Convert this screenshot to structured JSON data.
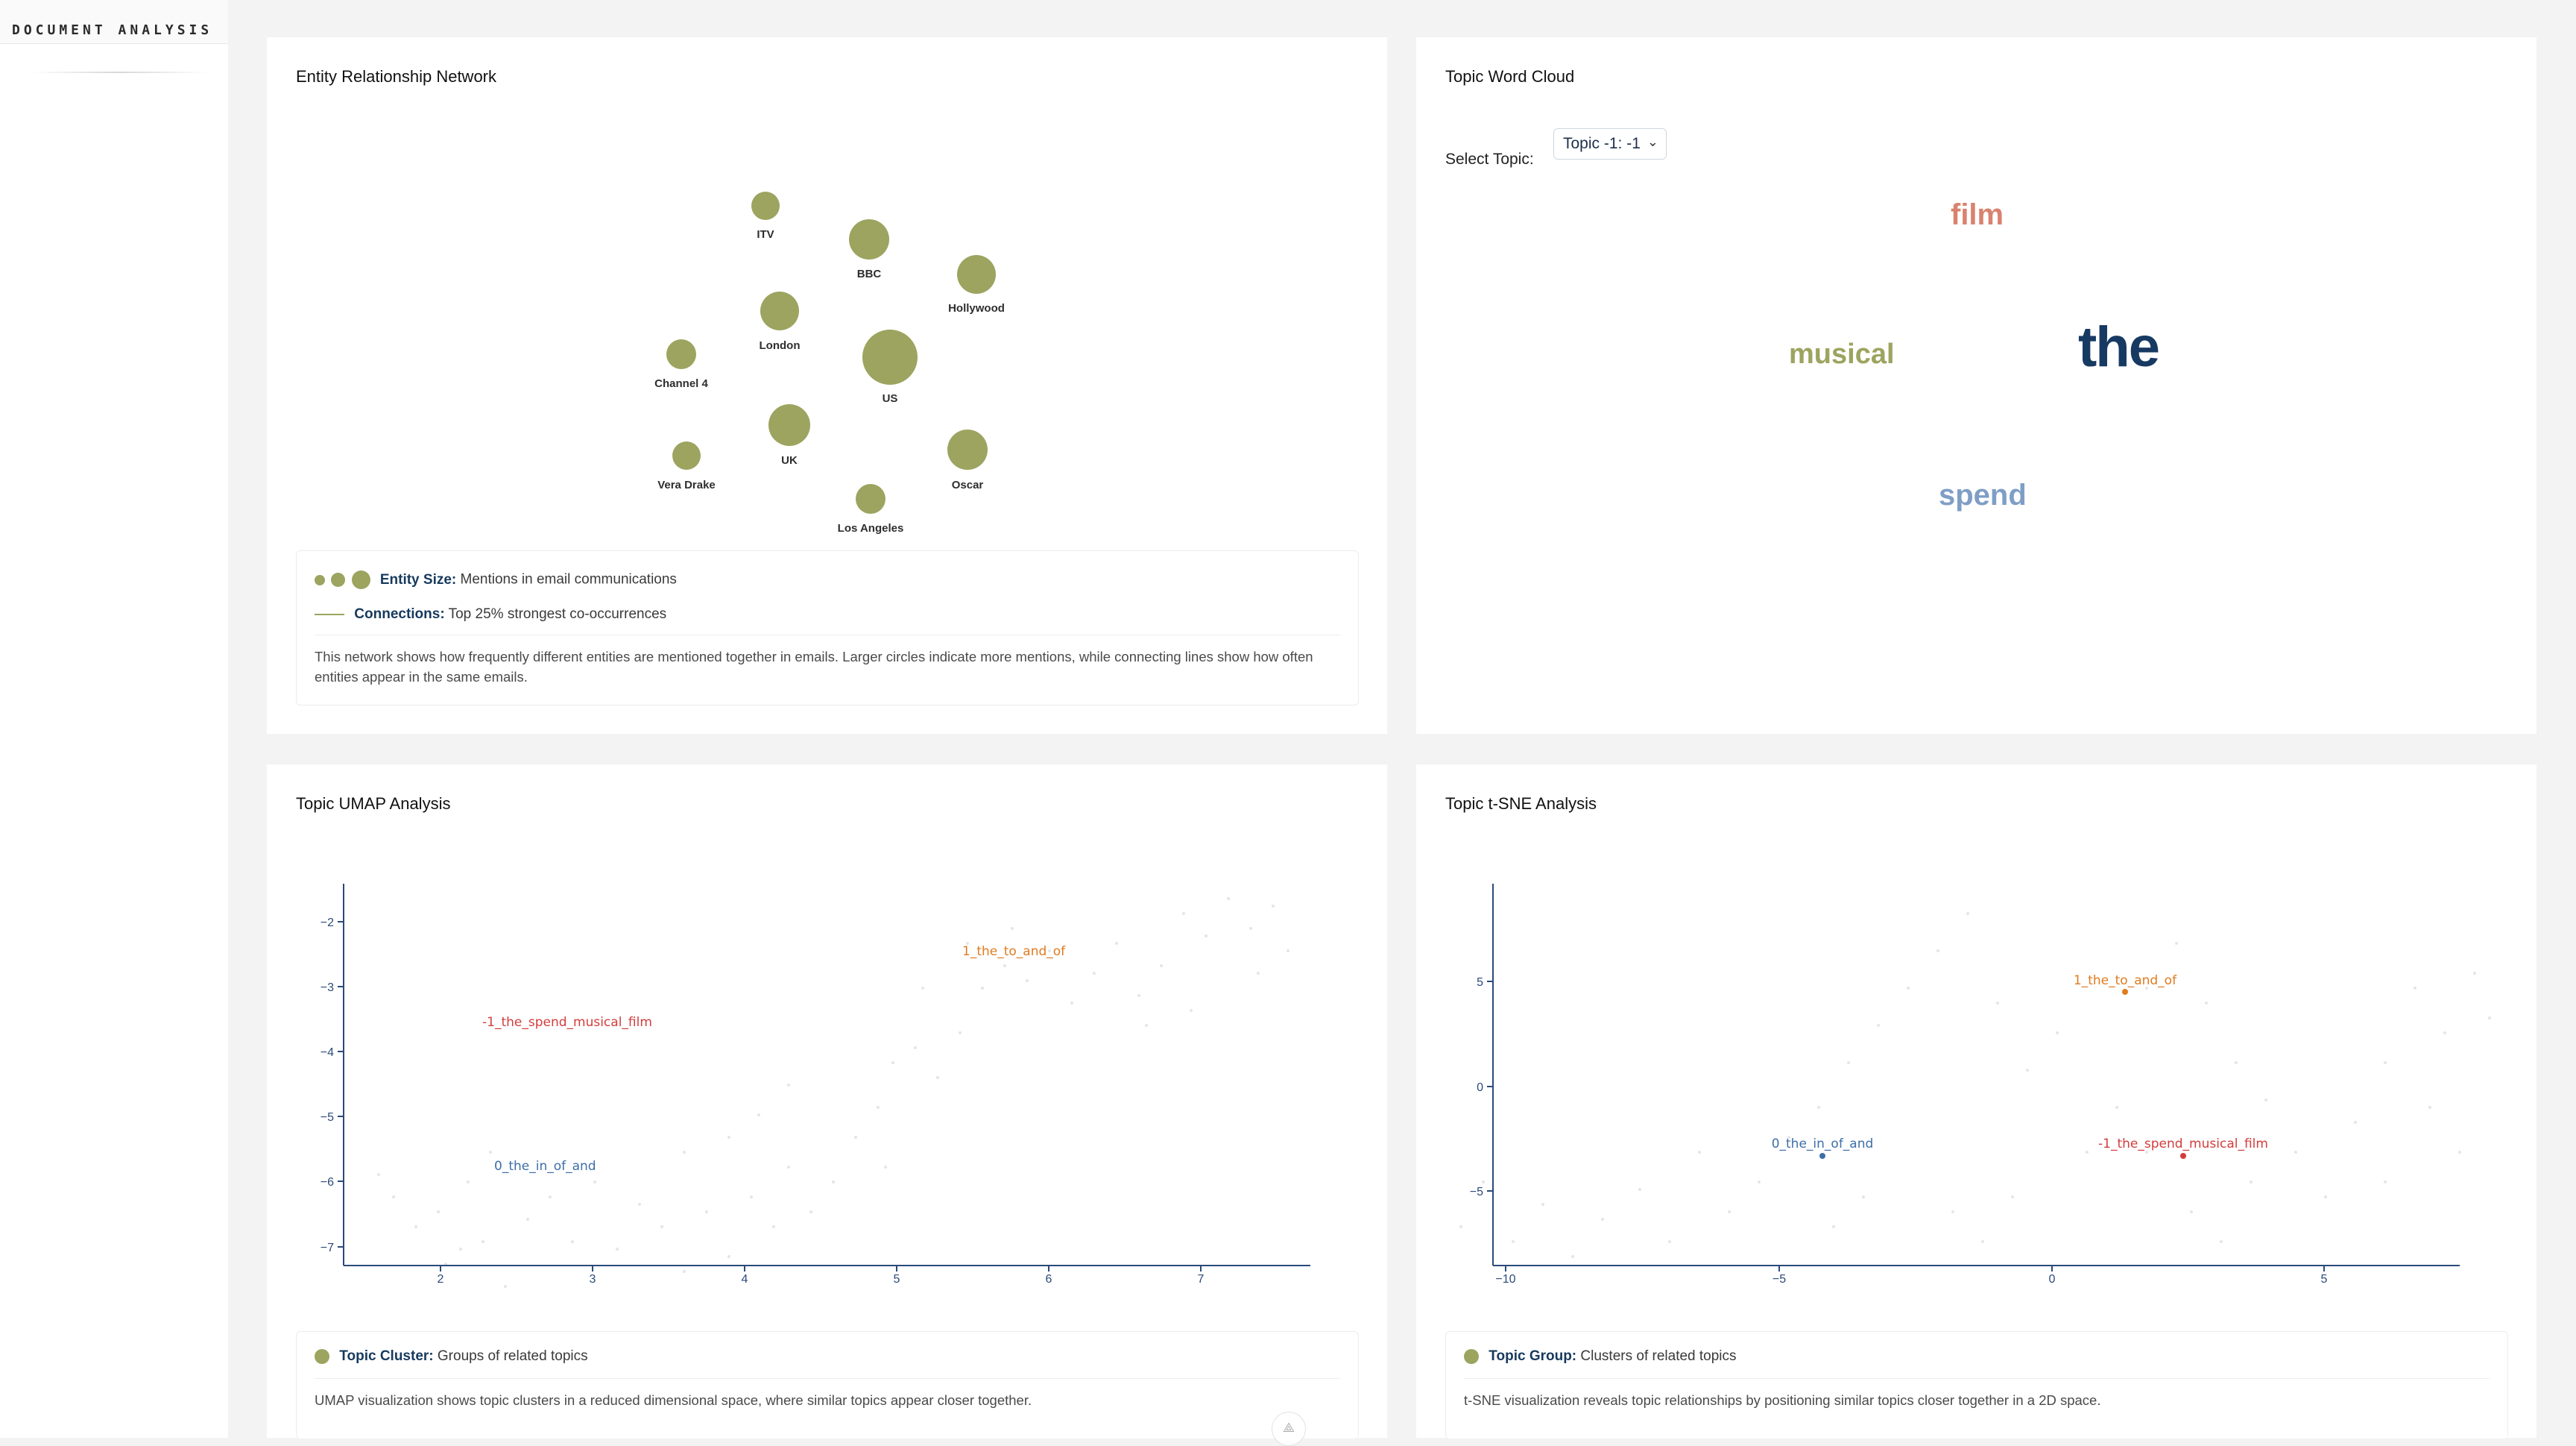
{
  "sidebar": {
    "brand": "DOCUMENT ANALYSIS"
  },
  "network": {
    "title": "Entity Relationship Network",
    "nodes": [
      {
        "label": "ITV"
      },
      {
        "label": "BBC"
      },
      {
        "label": "Hollywood"
      },
      {
        "label": "London"
      },
      {
        "label": "US"
      },
      {
        "label": "Channel 4"
      },
      {
        "label": "UK"
      },
      {
        "label": "Vera Drake"
      },
      {
        "label": "Oscar"
      },
      {
        "label": "Los Angeles"
      }
    ],
    "legend": {
      "size_key": "Entity Size:",
      "size_desc": "Mentions in email communications",
      "conn_key": "Connections:",
      "conn_desc": "Top 25% strongest co-occurrences",
      "description": "This network shows how frequently different entities are mentioned together in emails. Larger circles indicate more mentions, while connecting lines show how often entities appear in the same emails."
    }
  },
  "wordcloud": {
    "title": "Topic Word Cloud",
    "select_label": "Select Topic:",
    "select_value": "Topic -1: -1",
    "words": [
      {
        "text": "film",
        "color": "#d9826e"
      },
      {
        "text": "musical",
        "color": "#9ca45f"
      },
      {
        "text": "the",
        "color": "#173a63"
      },
      {
        "text": "spend",
        "color": "#7f9ec6"
      }
    ]
  },
  "umap": {
    "title": "Topic UMAP Analysis",
    "x_ticks": [
      "2",
      "3",
      "4",
      "5",
      "6",
      "7"
    ],
    "y_ticks": [
      "−2",
      "−3",
      "−4",
      "−5",
      "−6",
      "−7"
    ],
    "clusters": [
      {
        "label": "1_the_to_and_of",
        "color": "#e07b1f"
      },
      {
        "label": "-1_the_spend_musical_film",
        "color": "#d43c3c"
      },
      {
        "label": "0_the_in_of_and",
        "color": "#3d6ea8"
      }
    ],
    "legend_key": "Topic Cluster:",
    "legend_desc": "Groups of related topics",
    "description": "UMAP visualization shows topic clusters in a reduced dimensional space, where similar topics appear closer together."
  },
  "tsne": {
    "title": "Topic t-SNE Analysis",
    "x_ticks": [
      "−10",
      "−5",
      "0",
      "5"
    ],
    "y_ticks": [
      "5",
      "0",
      "−5"
    ],
    "clusters": [
      {
        "label": "1_the_to_and_of",
        "color": "#e07b1f"
      },
      {
        "label": "0_the_in_of_and",
        "color": "#3d6ea8"
      },
      {
        "label": "-1_the_spend_musical_film",
        "color": "#d43c3c"
      }
    ],
    "legend_key": "Topic Group:",
    "legend_desc": "Clusters of related topics",
    "description": "t-SNE visualization reveals topic relationships by positioning similar topics closer together in a 2D space."
  },
  "colors": {
    "node": "#9ca45f",
    "axis": "#2b4a7a",
    "accent_text": "#173a5e"
  }
}
